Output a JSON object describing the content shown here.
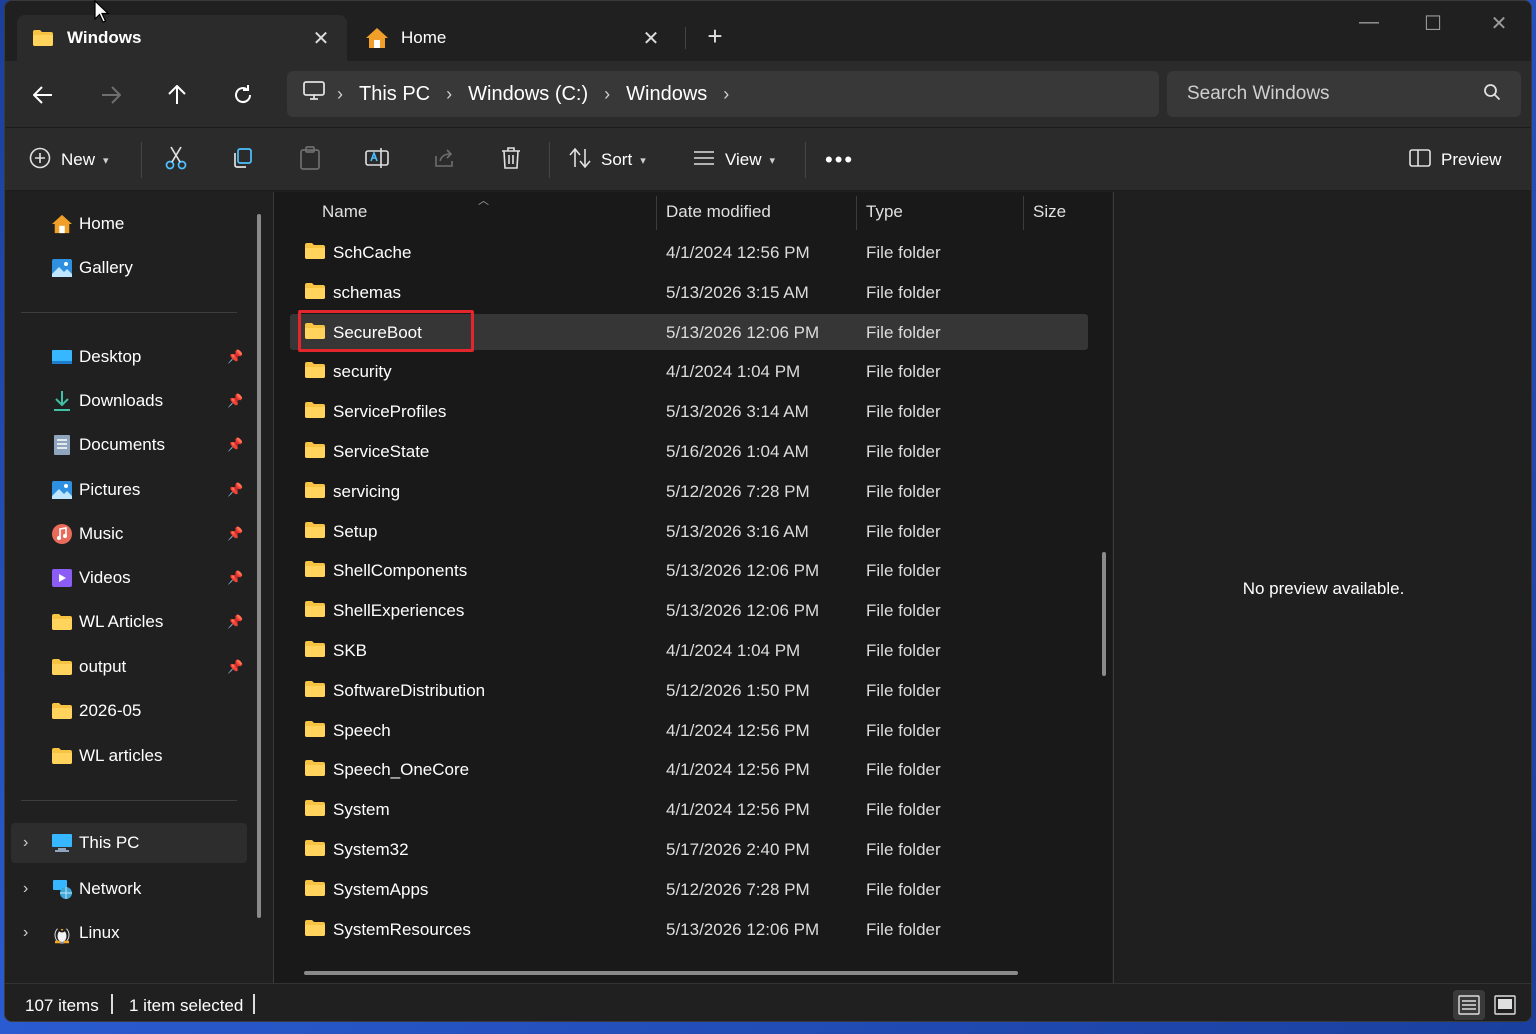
{
  "tabs": [
    {
      "label": "Windows",
      "icon": "folder-icon",
      "active": true
    },
    {
      "label": "Home",
      "icon": "home-icon",
      "active": false
    }
  ],
  "address": {
    "breadcrumb": [
      "This PC",
      "Windows (C:)",
      "Windows"
    ],
    "search_placeholder": "Search Windows"
  },
  "toolbar": {
    "new_label": "New",
    "sort_label": "Sort",
    "view_label": "View",
    "preview_label": "Preview"
  },
  "sidebar": {
    "top": [
      {
        "label": "Home",
        "icon": "home-icon"
      },
      {
        "label": "Gallery",
        "icon": "gallery-icon"
      }
    ],
    "quick": [
      {
        "label": "Desktop",
        "icon": "desktop-icon",
        "pinned": true
      },
      {
        "label": "Downloads",
        "icon": "downloads-icon",
        "pinned": true
      },
      {
        "label": "Documents",
        "icon": "documents-icon",
        "pinned": true
      },
      {
        "label": "Pictures",
        "icon": "pictures-icon",
        "pinned": true
      },
      {
        "label": "Music",
        "icon": "music-icon",
        "pinned": true
      },
      {
        "label": "Videos",
        "icon": "videos-icon",
        "pinned": true
      },
      {
        "label": "WL Articles",
        "icon": "folder-icon",
        "pinned": true
      },
      {
        "label": "output",
        "icon": "folder-icon",
        "pinned": true
      },
      {
        "label": "2026-05",
        "icon": "folder-icon",
        "pinned": false
      },
      {
        "label": "WL articles",
        "icon": "folder-icon",
        "pinned": false
      }
    ],
    "locations": [
      {
        "label": "This PC",
        "icon": "pc-icon",
        "selected": true
      },
      {
        "label": "Network",
        "icon": "network-icon",
        "selected": false
      },
      {
        "label": "Linux",
        "icon": "linux-icon",
        "selected": false
      }
    ]
  },
  "columns": {
    "name": "Name",
    "date": "Date modified",
    "type": "Type",
    "size": "Size"
  },
  "files": [
    {
      "name": "SchCache",
      "date": "4/1/2024 12:56 PM",
      "type": "File folder"
    },
    {
      "name": "schemas",
      "date": "5/13/2026 3:15 AM",
      "type": "File folder"
    },
    {
      "name": "SecureBoot",
      "date": "5/13/2026 12:06 PM",
      "type": "File folder",
      "selected": true
    },
    {
      "name": "security",
      "date": "4/1/2024 1:04 PM",
      "type": "File folder"
    },
    {
      "name": "ServiceProfiles",
      "date": "5/13/2026 3:14 AM",
      "type": "File folder"
    },
    {
      "name": "ServiceState",
      "date": "5/16/2026 1:04 AM",
      "type": "File folder"
    },
    {
      "name": "servicing",
      "date": "5/12/2026 7:28 PM",
      "type": "File folder"
    },
    {
      "name": "Setup",
      "date": "5/13/2026 3:16 AM",
      "type": "File folder"
    },
    {
      "name": "ShellComponents",
      "date": "5/13/2026 12:06 PM",
      "type": "File folder"
    },
    {
      "name": "ShellExperiences",
      "date": "5/13/2026 12:06 PM",
      "type": "File folder"
    },
    {
      "name": "SKB",
      "date": "4/1/2024 1:04 PM",
      "type": "File folder"
    },
    {
      "name": "SoftwareDistribution",
      "date": "5/12/2026 1:50 PM",
      "type": "File folder"
    },
    {
      "name": "Speech",
      "date": "4/1/2024 12:56 PM",
      "type": "File folder"
    },
    {
      "name": "Speech_OneCore",
      "date": "4/1/2024 12:56 PM",
      "type": "File folder"
    },
    {
      "name": "System",
      "date": "4/1/2024 12:56 PM",
      "type": "File folder"
    },
    {
      "name": "System32",
      "date": "5/17/2026 2:40 PM",
      "type": "File folder"
    },
    {
      "name": "SystemApps",
      "date": "5/12/2026 7:28 PM",
      "type": "File folder"
    },
    {
      "name": "SystemResources",
      "date": "5/13/2026 12:06 PM",
      "type": "File folder"
    }
  ],
  "preview": {
    "message": "No preview available."
  },
  "status": {
    "items_count": "107 items",
    "selected_count": "1 item selected"
  },
  "colors": {
    "highlight": "#e3262b",
    "folder": "#f6c343",
    "accent": "#4cc2ff"
  }
}
